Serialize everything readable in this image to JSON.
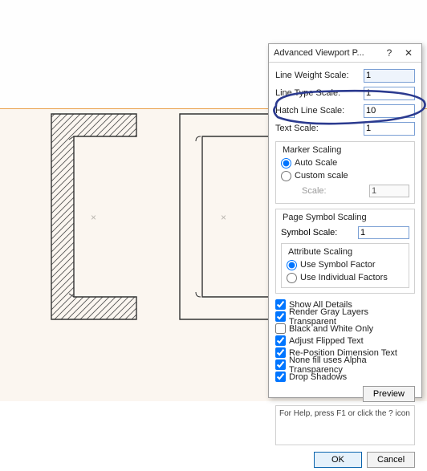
{
  "dialog": {
    "title": "Advanced Viewport P...",
    "help_btn": "?",
    "close_btn": "✕",
    "line_weight_label": "Line Weight Scale:",
    "line_weight_value": "1",
    "line_type_label": "Line Type Scale:",
    "line_type_value": "1",
    "hatch_label": "Hatch Line Scale:",
    "hatch_value": "10",
    "text_scale_label": "Text Scale:",
    "text_scale_value": "1",
    "marker_legend": "Marker Scaling",
    "marker_auto": "Auto Scale",
    "marker_custom": "Custom scale",
    "marker_scale_label": "Scale:",
    "marker_scale_value": "1",
    "page_legend": "Page Symbol Scaling",
    "symbol_scale_label": "Symbol Scale:",
    "symbol_scale_value": "1",
    "attr_legend": "Attribute Scaling",
    "attr_use_symbol": "Use Symbol Factor",
    "attr_use_individual": "Use Individual Factors",
    "checks": [
      {
        "label": "Show All Details",
        "checked": true
      },
      {
        "label": "Render Gray Layers Transparent",
        "checked": true
      },
      {
        "label": "Black and White Only",
        "checked": false
      },
      {
        "label": "Adjust Flipped Text",
        "checked": true
      },
      {
        "label": "Re-Position Dimension Text",
        "checked": true
      },
      {
        "label": "None fill uses Alpha Transparency",
        "checked": true
      },
      {
        "label": "Drop Shadows",
        "checked": true
      }
    ],
    "preview_btn": "Preview",
    "help_text": "For Help, press F1 or click the ? icon",
    "ok_btn": "OK",
    "cancel_btn": "Cancel"
  }
}
